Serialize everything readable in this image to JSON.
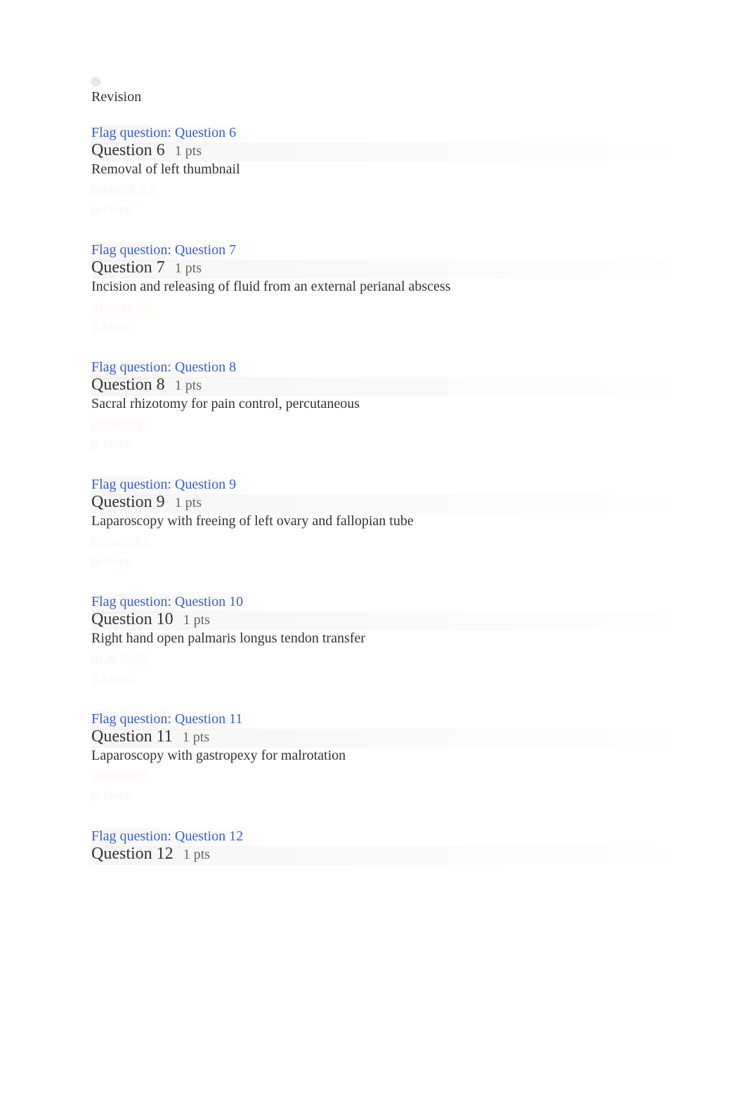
{
  "top": {
    "radio_hidden_label": "",
    "revision_label": "Revision"
  },
  "questions": [
    {
      "flag_label": "Flag question: Question 6",
      "title": "Question 6",
      "pts": "1 pts",
      "text": "Removal of left thumbnail",
      "answer_blur1": "0HBQXZZ",
      "answer_blur2": "p.1weu"
    },
    {
      "flag_label": "Flag question: Question 7",
      "title": "Question 7",
      "pts": "1 pts",
      "text": "Incision and releasing of fluid from an external perianal abscess",
      "answer_blur1": "0D9QXZZ",
      "answer_blur2": "p.1weu"
    },
    {
      "flag_label": "Flag question: Question 8",
      "title": "Question 8",
      "pts": "1 pts",
      "text": "Sacral rhizotomy for pain control, percutaneous",
      "answer_blur1": "018R3ZZ",
      "answer_blur2": "p.1weu"
    },
    {
      "flag_label": "Flag question: Question 9",
      "title": "Question 9",
      "pts": "1 pts",
      "text": "Laparoscopy with freeing of left ovary and fallopian tube",
      "answer_blur1": "0UN14ZZ",
      "answer_blur2": "p.1weu"
    },
    {
      "flag_label": "Flag question: Question 10",
      "title": "Question 10",
      "pts": "1 pts",
      "text": "Right hand open palmaris longus tendon transfer",
      "answer_blur1": "0LX70ZZ",
      "answer_blur2": "p.1weu"
    },
    {
      "flag_label": "Flag question: Question 11",
      "title": "Question 11",
      "pts": "1 pts",
      "text": "Laparoscopy with gastropexy for malrotation",
      "answer_blur1": "0DS64ZZ",
      "answer_blur2": "p.1weu"
    },
    {
      "flag_label": "Flag question: Question 12",
      "title": "Question 12",
      "pts": "1 pts",
      "text": "",
      "answer_blur1": "",
      "answer_blur2": ""
    }
  ]
}
